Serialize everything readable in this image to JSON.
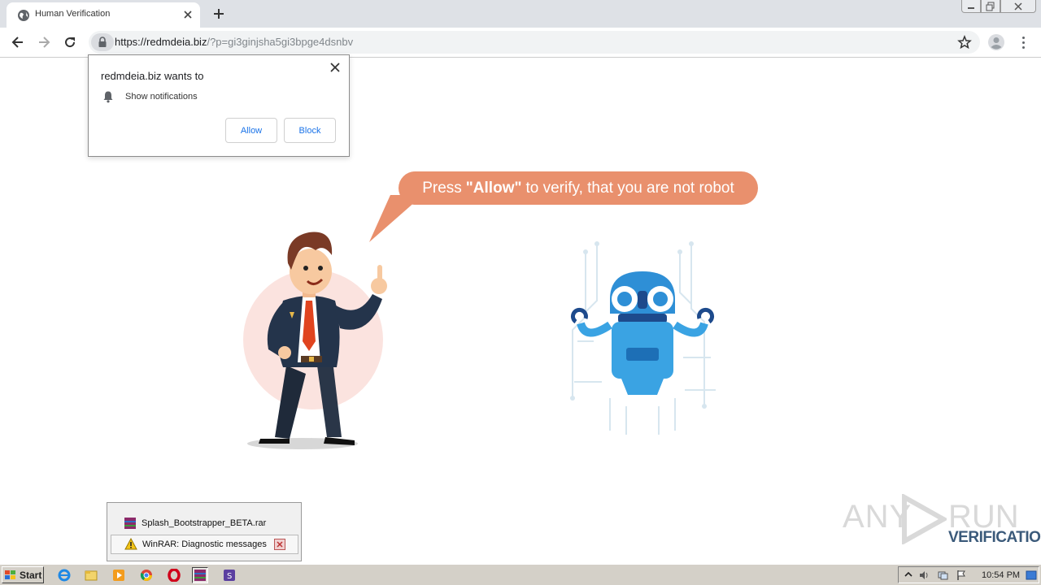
{
  "browser": {
    "tab": {
      "title": "Human Verification"
    },
    "address": {
      "host": "https://redmdeia.biz",
      "path": "/?p=gi3ginjsha5gi3bpge4dsnbv"
    }
  },
  "permission_prompt": {
    "title": "redmdeia.biz wants to",
    "permission": "Show notifications",
    "allow_label": "Allow",
    "block_label": "Block"
  },
  "page": {
    "bubble_pre": "Press",
    "bubble_bold": "\"Allow\"",
    "bubble_post": "to verify, that you are not robot",
    "bubble_color": "#e9906d"
  },
  "watermark": {
    "word1": "ANY",
    "word2": "RUN",
    "sub": "VERIFICATION"
  },
  "taskbar_popup": {
    "items": [
      {
        "label": "Splash_Bootstrapper_BETA.rar",
        "icon": "winrar-icon"
      },
      {
        "label": "WinRAR: Diagnostic messages",
        "icon": "warning-icon"
      }
    ]
  },
  "taskbar": {
    "start_label": "Start",
    "clock": "10:54 PM",
    "quick_launch": [
      "ie-icon",
      "explorer-icon",
      "media-player-icon",
      "chrome-icon",
      "opera-icon",
      "winrar-icon",
      "app-icon"
    ]
  }
}
